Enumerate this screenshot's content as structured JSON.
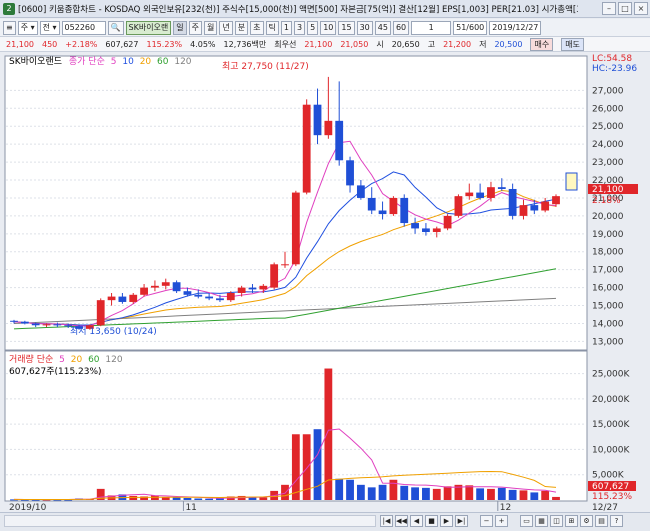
{
  "window": {
    "title": "[0600] 키움종합차트 - KOSDAQ 외국인보유[232(천)] 주식수[15,000(천)] 액면[500] 자본금[75(억)] 결산[12월] EPS[1,003] PER[21.03] 시가총액[3",
    "app_num": "2",
    "btn_min": "–",
    "btn_max": "□",
    "btn_close": "×"
  },
  "toolbar": {
    "item0": "≡",
    "item1": "주 ▾",
    "item2": "전 ▾",
    "code": "052260",
    "search": "🔍",
    "name_sel": "SK바이오랜",
    "t_day": "일",
    "t_week": "주",
    "t_month": "월",
    "t_year": "년",
    "t_min": "분",
    "t_tick": "초",
    "t_tick2": "틱",
    "p1": "1",
    "p3": "3",
    "p5": "5",
    "p10": "10",
    "p15": "15",
    "p30": "30",
    "p45": "45",
    "p60": "60",
    "p_one": "1",
    "count": "51/600",
    "date": "2019/12/27"
  },
  "quote": {
    "price": "21,100",
    "change": "450",
    "change_pct": "+2.18%",
    "volume": "607,627",
    "volume_pct": "115.23%",
    "pct2": "4.05%",
    "amount": "12,736백만",
    "label_high": "최우선",
    "ask": "21,100",
    "bid": "21,050",
    "label_open": "시",
    "open": "20,650",
    "label_hi": "고",
    "hi": "21,200",
    "label_low": "저",
    "low": "20,500",
    "buy_label": "매수",
    "sell_label": "매도"
  },
  "legend": {
    "name": "SK바이오랜드",
    "ma_label": "종가 단순",
    "ma5": "5",
    "ma10": "10",
    "ma20": "20",
    "ma60": "60",
    "ma120": "120",
    "vol_label": "거래량 단순",
    "vma5": "5",
    "vma20": "20",
    "vma60": "60",
    "vma120": "120",
    "vol_value": "607,627주(115.23%)",
    "lc": "LC:54.58",
    "hc": "HC:-23.96",
    "high_note": "최고 27,750 (11/27)",
    "low_note": "최저 13,650 (10/24)"
  },
  "colors": {
    "up": "#e0262a",
    "down": "#1f4fd6",
    "ma5": "#e040c0",
    "ma10": "#2050e0",
    "ma20": "#f0a000",
    "ma60": "#30a030",
    "ma120": "#808080"
  },
  "price_axis": [
    "27,000",
    "26,000",
    "25,000",
    "24,000",
    "23,000",
    "22,000",
    "21,000",
    "20,000",
    "19,000",
    "18,000",
    "17,000",
    "16,000",
    "15,000",
    "14,000",
    "13,000"
  ],
  "current_price_tag": "21,100",
  "current_pct_tag": "2.18%",
  "volume_axis": [
    "25,000K",
    "20,000K",
    "15,000K",
    "10,000K",
    "5,000K"
  ],
  "volume_tag": "607,627",
  "volume_pct_tag": "115.23%",
  "date_labels": [
    "2019/10",
    "11",
    "12",
    "12/27"
  ],
  "candles": [
    [
      14150,
      14200,
      14000,
      14100
    ],
    [
      14100,
      14150,
      13950,
      14000
    ],
    [
      14000,
      14050,
      13800,
      13900
    ],
    [
      13900,
      14000,
      13800,
      13950
    ],
    [
      13950,
      14050,
      13800,
      13900
    ],
    [
      13900,
      14000,
      13750,
      13850
    ],
    [
      13850,
      13950,
      13650,
      13700
    ],
    [
      13700,
      13950,
      13650,
      13900
    ],
    [
      13900,
      15400,
      13850,
      15300
    ],
    [
      15300,
      15700,
      15000,
      15500
    ],
    [
      15500,
      15700,
      15100,
      15200
    ],
    [
      15200,
      15700,
      15100,
      15600
    ],
    [
      15600,
      16200,
      15500,
      16000
    ],
    [
      16000,
      16400,
      15800,
      16100
    ],
    [
      16100,
      16500,
      15900,
      16300
    ],
    [
      16300,
      16400,
      15700,
      15800
    ],
    [
      15800,
      16000,
      15500,
      15600
    ],
    [
      15600,
      15900,
      15400,
      15500
    ],
    [
      15500,
      15700,
      15300,
      15400
    ],
    [
      15400,
      15600,
      15200,
      15300
    ],
    [
      15300,
      15800,
      15200,
      15700
    ],
    [
      15700,
      16100,
      15500,
      16000
    ],
    [
      16000,
      16200,
      15700,
      15900
    ],
    [
      15900,
      16200,
      15700,
      16100
    ],
    [
      16000,
      17400,
      15900,
      17300
    ],
    [
      17300,
      18000,
      17100,
      17300
    ],
    [
      17300,
      21400,
      17200,
      21300
    ],
    [
      21300,
      26500,
      21200,
      26200
    ],
    [
      26200,
      27100,
      24000,
      24500
    ],
    [
      24500,
      27750,
      24300,
      25300
    ],
    [
      25300,
      27500,
      22800,
      23100
    ],
    [
      23100,
      23300,
      21300,
      21700
    ],
    [
      21700,
      22000,
      20900,
      21000
    ],
    [
      21000,
      21600,
      20100,
      20300
    ],
    [
      20300,
      20800,
      19800,
      20100
    ],
    [
      20100,
      21100,
      20000,
      21000
    ],
    [
      21000,
      21200,
      19400,
      19600
    ],
    [
      19600,
      19900,
      19000,
      19300
    ],
    [
      19300,
      19600,
      18900,
      19100
    ],
    [
      19100,
      19400,
      18800,
      19300
    ],
    [
      19300,
      20100,
      19200,
      20000
    ],
    [
      20000,
      21200,
      19900,
      21100
    ],
    [
      21100,
      21800,
      20900,
      21300
    ],
    [
      21300,
      21800,
      20900,
      21000
    ],
    [
      21000,
      21900,
      20800,
      21600
    ],
    [
      21600,
      22100,
      21400,
      21500
    ],
    [
      21500,
      21800,
      19800,
      20000
    ],
    [
      20000,
      20900,
      19800,
      20600
    ],
    [
      20600,
      20900,
      20100,
      20300
    ],
    [
      20300,
      21000,
      20200,
      20800
    ],
    [
      20650,
      21200,
      20500,
      21100
    ]
  ],
  "volumes": [
    120,
    90,
    80,
    110,
    100,
    90,
    300,
    200,
    2200,
    900,
    1100,
    800,
    700,
    900,
    600,
    500,
    400,
    300,
    250,
    300,
    700,
    800,
    600,
    500,
    1800,
    3000,
    13000,
    13000,
    14000,
    26000,
    4200,
    4000,
    3000,
    2500,
    3000,
    4000,
    2800,
    2500,
    2400,
    2200,
    2700,
    3000,
    2900,
    2300,
    2200,
    2400,
    2000,
    1900,
    1500,
    1800,
    607
  ]
}
